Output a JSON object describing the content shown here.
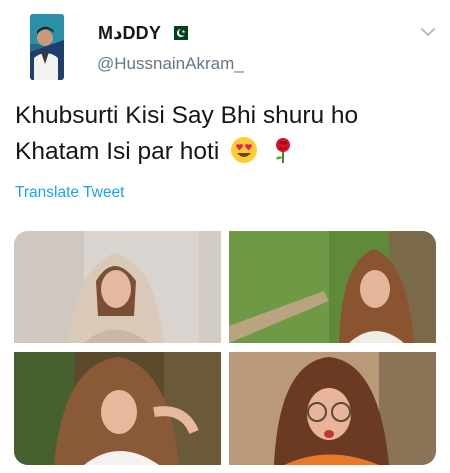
{
  "tweet": {
    "display_name": "MدDDY",
    "handle": "@HussnainAkram_",
    "text_line1": "Khubsurti Kisi Say Bhi shuru ho",
    "text_line2": "Khatam Isi par hoti",
    "emojis": [
      "heart-eyes-icon",
      "rose-icon"
    ],
    "translate_label": "Translate Tweet"
  },
  "colors": {
    "text": "#14171a",
    "secondary": "#657786",
    "link": "#1da1f2",
    "flag_green": "#01411c"
  }
}
